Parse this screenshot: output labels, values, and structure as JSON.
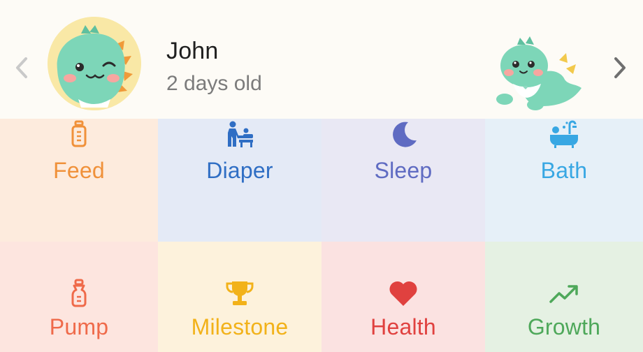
{
  "profile": {
    "name": "John",
    "age": "2 days old",
    "avatar_icon": "dino-avatar-icon",
    "mascot_icon": "crawling-dino-icon"
  },
  "navigation": {
    "prev_icon": "chevron-left-icon",
    "next_icon": "chevron-right-icon"
  },
  "activities": [
    {
      "label": "Feed",
      "icon": "bottle-icon",
      "color": "#f0913a",
      "background": "#fdebdd"
    },
    {
      "label": "Diaper",
      "icon": "diaper-change-icon",
      "color": "#2f6ec4",
      "background": "#e4eaf6"
    },
    {
      "label": "Sleep",
      "icon": "moon-icon",
      "color": "#5f6bc2",
      "background": "#e9e8f4"
    },
    {
      "label": "Bath",
      "icon": "bathtub-icon",
      "color": "#38a7e3",
      "background": "#e6f0f8"
    },
    {
      "label": "Pump",
      "icon": "pump-icon",
      "color": "#ef6a4a",
      "background": "#fde5df"
    },
    {
      "label": "Milestone",
      "icon": "trophy-icon",
      "color": "#f2b21a",
      "background": "#fdf2dc"
    },
    {
      "label": "Health",
      "icon": "heart-icon",
      "color": "#e0413f",
      "background": "#fbe2e1"
    },
    {
      "label": "Growth",
      "icon": "trend-up-icon",
      "color": "#4ea85a",
      "background": "#e5f1e3"
    }
  ]
}
